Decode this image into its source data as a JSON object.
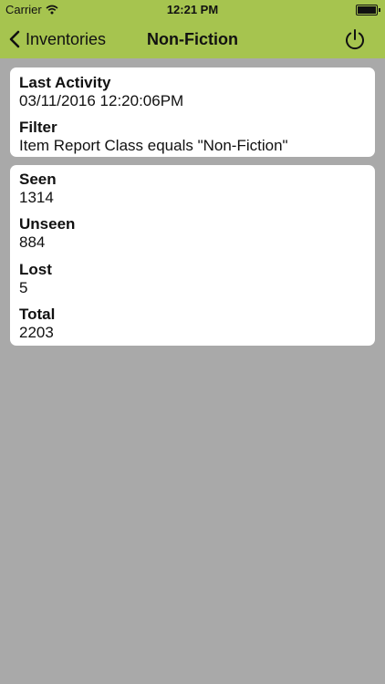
{
  "status_bar": {
    "carrier": "Carrier",
    "time": "12:21 PM",
    "wifi_icon": "wifi-icon",
    "battery_icon": "battery-icon"
  },
  "nav": {
    "back_label": "Inventories",
    "title": "Non-Fiction",
    "back_icon": "chevron-left-icon",
    "power_icon": "power-icon"
  },
  "summary": {
    "last_activity_label": "Last Activity",
    "last_activity_value": "03/11/2016 12:20:06PM",
    "filter_label": "Filter",
    "filter_value": "Item Report Class equals \"Non-Fiction\""
  },
  "counts": {
    "seen_label": "Seen",
    "seen_value": "1314",
    "unseen_label": "Unseen",
    "unseen_value": "884",
    "lost_label": "Lost",
    "lost_value": "5",
    "total_label": "Total",
    "total_value": "2203"
  },
  "colors": {
    "nav_bar": "#a6c44f",
    "background": "#a9a9a9",
    "card": "#ffffff"
  }
}
